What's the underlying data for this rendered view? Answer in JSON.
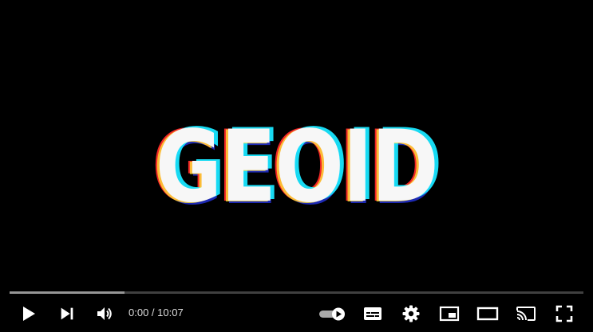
{
  "video": {
    "title_art": "GEOID"
  },
  "player": {
    "progress_played": 0.0,
    "progress_buffered": 0.2,
    "time_current": "0:00",
    "time_separator": " / ",
    "time_duration": "10:07",
    "autoplay_on": true,
    "colors": {
      "background": "#000000",
      "controls": "#ffffff",
      "played": "#ff0000"
    },
    "icons": [
      "play-icon",
      "next-icon",
      "volume-icon",
      "autoplay-toggle-icon",
      "subtitles-icon",
      "settings-gear-icon",
      "miniplayer-icon",
      "theater-mode-icon",
      "cast-icon",
      "fullscreen-icon"
    ]
  }
}
